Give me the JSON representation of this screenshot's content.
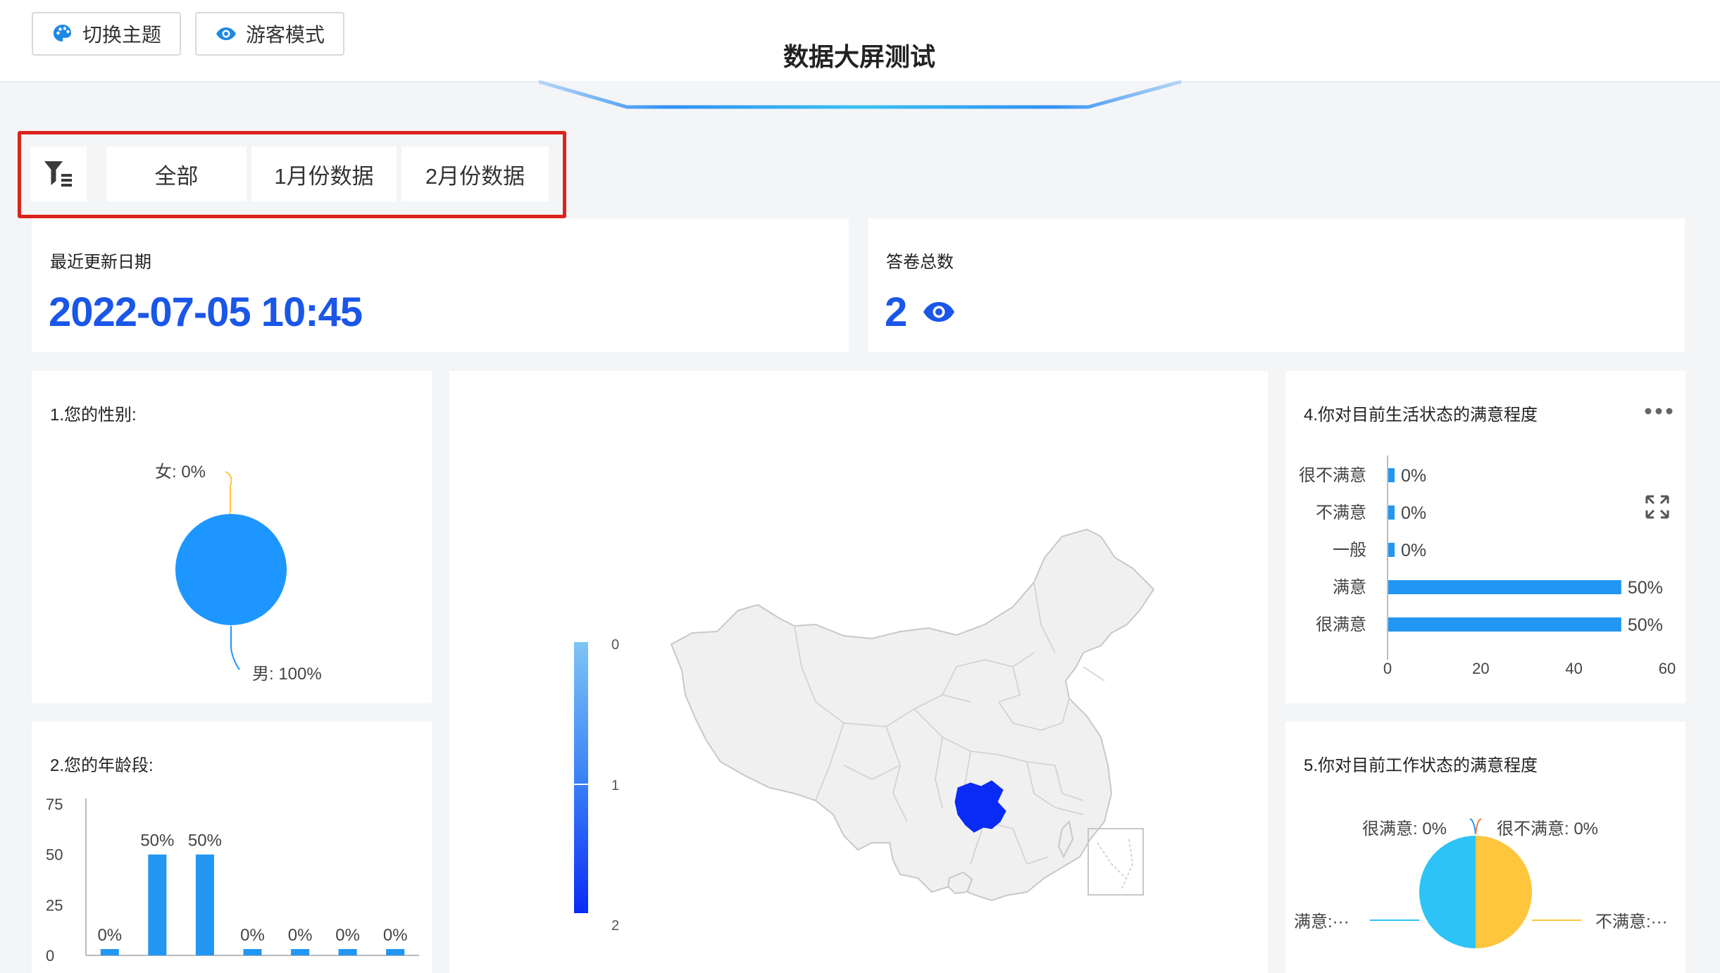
{
  "toolbar": {
    "theme_label": "切换主题",
    "guest_label": "游客模式"
  },
  "page_title": "数据大屏测试",
  "filters": {
    "tabs": [
      "全部",
      "1月份数据",
      "2月份数据"
    ]
  },
  "stats": {
    "last_update_label": "最近更新日期",
    "last_update_value": "2022-07-05 10:45",
    "total_label": "答卷总数",
    "total_value": "2"
  },
  "q1": {
    "title": "1.您的性别:",
    "labels": [
      "女: 0%",
      "男: 100%"
    ]
  },
  "q2": {
    "title": "2.您的年龄段:"
  },
  "q4": {
    "title": "4.你对目前生活状态的满意程度"
  },
  "q5": {
    "title": "5.你对目前工作状态的满意程度",
    "labels": [
      "很满意: 0%",
      "很不满意: 0%",
      "满意:···",
      "不满意:···"
    ]
  },
  "map": {
    "legend_ticks": [
      "0",
      "1",
      "2"
    ],
    "colors": {
      "low": "#7ec4f5",
      "high": "#0a2bf5",
      "highlight": "#0a2bf5",
      "region": "#f0f0f0"
    }
  },
  "colors": {
    "accent": "#1a56e8",
    "bar": "#2196f3",
    "pie_blue": "#1e96ff",
    "pie_cyan": "#2dc3f7",
    "pie_yellow": "#fdc63c",
    "filter_border": "#d9251d"
  },
  "chart_data": [
    {
      "type": "pie",
      "title": "1.您的性别:",
      "categories": [
        "女",
        "男"
      ],
      "values": [
        0,
        100
      ]
    },
    {
      "type": "bar",
      "title": "2.您的年龄段:",
      "categories": [
        "",
        "",
        "",
        "",
        "",
        "",
        ""
      ],
      "values": [
        0,
        50,
        50,
        0,
        0,
        0,
        0
      ],
      "data_labels": [
        "0%",
        "50%",
        "50%",
        "0%",
        "0%",
        "0%",
        "0%"
      ],
      "y_ticks": [
        "75",
        "50",
        "25",
        "0"
      ],
      "ylim": [
        0,
        75
      ]
    },
    {
      "type": "bar",
      "orientation": "horizontal",
      "title": "4.你对目前生活状态的满意程度",
      "categories": [
        "很不满意",
        "不满意",
        "一般",
        "满意",
        "很满意"
      ],
      "values": [
        0,
        0,
        0,
        50,
        50
      ],
      "data_labels": [
        "0%",
        "0%",
        "0%",
        "50%",
        "50%"
      ],
      "x_ticks": [
        "0",
        "20",
        "40",
        "60"
      ],
      "xlim": [
        0,
        60
      ]
    },
    {
      "type": "pie",
      "title": "5.你对目前工作状态的满意程度",
      "categories": [
        "很满意",
        "很不满意",
        "满意",
        "不满意"
      ],
      "values": [
        0,
        0,
        50,
        50
      ],
      "data_labels": [
        "很满意: 0%",
        "很不满意: 0%",
        "满意:···",
        "不满意:···"
      ]
    }
  ]
}
